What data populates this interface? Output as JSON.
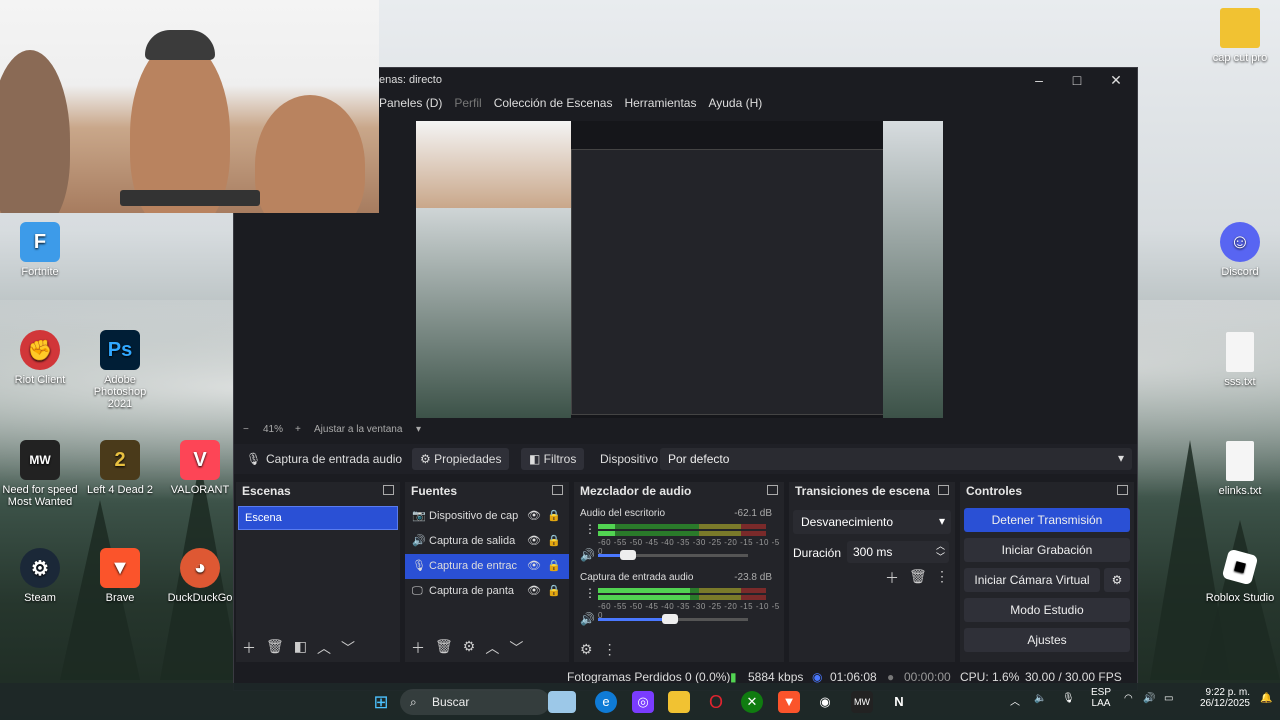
{
  "obs": {
    "title": "enas: directo",
    "menu": {
      "panels": "Paneles (D)",
      "profile": "Perfil",
      "collections": "Colección de Escenas",
      "tools": "Herramientas",
      "help": "Ayuda (H)"
    },
    "zoom": {
      "minus": "−",
      "value": "41%",
      "plus": "+",
      "fit": "Ajustar a la ventana"
    },
    "source_bar": {
      "selected_source": "Captura de entrada audio",
      "properties": "Propiedades",
      "filters": "Filtros",
      "device_label": "Dispositivo",
      "device_value": "Por defecto"
    },
    "scenes": {
      "title": "Escenas",
      "items": [
        "Escena"
      ]
    },
    "sources": {
      "title": "Fuentes",
      "items": [
        {
          "label": "Dispositivo de cap",
          "icon": "camera-icon",
          "selected": false
        },
        {
          "label": "Captura de salida",
          "icon": "speaker-icon",
          "selected": false
        },
        {
          "label": "Captura de entrac",
          "icon": "microphone-icon",
          "selected": true
        },
        {
          "label": "Captura de panta",
          "icon": "monitor-icon",
          "selected": false
        }
      ]
    },
    "mixer": {
      "title": "Mezclador de audio",
      "ticks": "-60 -55 -50 -45 -40 -35 -30 -25 -20 -15 -10 -5 0",
      "channels": [
        {
          "name": "Audio del escritorio",
          "db": "-62.1 dB",
          "level": 0.1,
          "volume": 0.2
        },
        {
          "name": "Captura de entrada audio",
          "db": "-23.8 dB",
          "level": 0.55,
          "volume": 0.48
        }
      ]
    },
    "transitions": {
      "title": "Transiciones de escena",
      "type": "Desvanecimiento",
      "duration_label": "Duración",
      "duration_value": "300 ms"
    },
    "controls": {
      "title": "Controles",
      "stop_stream": "Detener Transmisión",
      "start_recording": "Iniciar Grabación",
      "virtual_cam": "Iniciar Cámara Virtual",
      "studio_mode": "Modo Estudio",
      "settings": "Ajustes"
    },
    "status": {
      "dropped_frames": "Fotogramas Perdidos 0 (0.0%)",
      "bitrate": "5884 kbps",
      "stream_time": "01:06:08",
      "rec_time": "00:00:00",
      "cpu": "CPU: 1.6%",
      "fps": "30.00 / 30.00 FPS"
    }
  },
  "desktop_icons": [
    {
      "label": "cap cut pro",
      "icon": "folder-icon"
    },
    {
      "label": "Discord",
      "icon": "discord-icon"
    },
    {
      "label": "sss.txt",
      "icon": "text-file-icon"
    },
    {
      "label": "elinks.txt",
      "icon": "text-file-icon"
    },
    {
      "label": "Roblox Studio",
      "icon": "roblox-studio-icon"
    },
    {
      "label": "Fortnite",
      "icon": "fortnite-icon"
    },
    {
      "label": "Riot Client",
      "icon": "riot-client-icon"
    },
    {
      "label": "Adobe Photoshop 2021",
      "icon": "photoshop-icon"
    },
    {
      "label": "Need for speed Most Wanted",
      "icon": "nfs-icon"
    },
    {
      "label": "Left 4 Dead 2",
      "icon": "l4d2-icon"
    },
    {
      "label": "VALORANT",
      "icon": "valorant-icon"
    },
    {
      "label": "Steam",
      "icon": "steam-icon"
    },
    {
      "label": "Brave",
      "icon": "brave-icon"
    },
    {
      "label": "DuckDuckGo",
      "icon": "duckduckgo-icon"
    }
  ],
  "taskbar": {
    "search_placeholder": "Buscar",
    "lang_top": "ESP",
    "lang_bottom": "LAA",
    "time": "9:22 p. m.",
    "date": "26/12/2025"
  },
  "colors": {
    "accent": "#2a50d5",
    "panel": "#232429",
    "window": "#1b1c21"
  }
}
